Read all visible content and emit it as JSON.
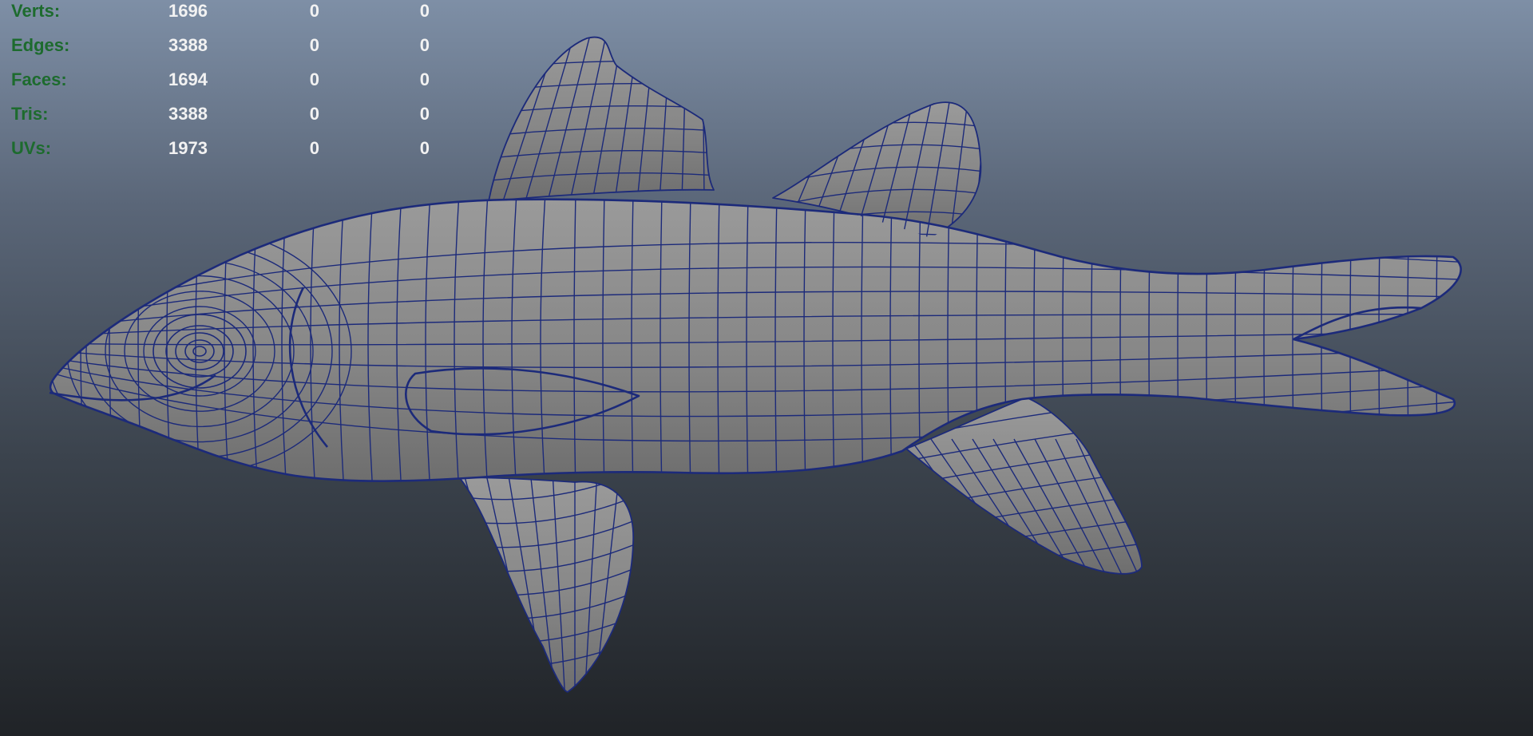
{
  "poly_count": {
    "rows": [
      {
        "label": "Verts:",
        "values": [
          "1696",
          "0",
          "0"
        ]
      },
      {
        "label": "Edges:",
        "values": [
          "3388",
          "0",
          "0"
        ]
      },
      {
        "label": "Faces:",
        "values": [
          "1694",
          "0",
          "0"
        ]
      },
      {
        "label": "Tris:",
        "values": [
          "3388",
          "0",
          "0"
        ]
      },
      {
        "label": "UVs:",
        "values": [
          "1973",
          "0",
          "0"
        ]
      }
    ]
  },
  "colors": {
    "label_green": "#1d6b2e",
    "value_white": "#f2f2f2",
    "mesh_fill": "#888888",
    "wire": "#1c2a7a"
  },
  "model": {
    "icon": "fish-wireframe-mesh"
  }
}
